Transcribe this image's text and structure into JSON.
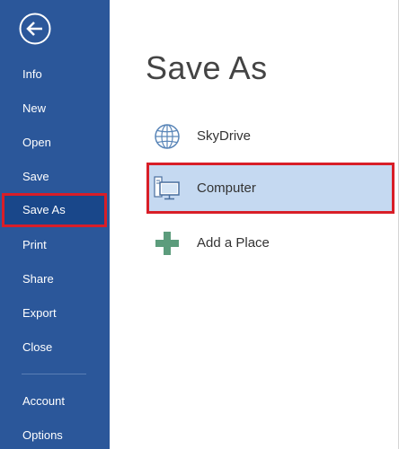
{
  "sidebar": {
    "back_label": "Back",
    "items": [
      {
        "label": "Info"
      },
      {
        "label": "New"
      },
      {
        "label": "Open"
      },
      {
        "label": "Save"
      },
      {
        "label": "Save As"
      },
      {
        "label": "Print"
      },
      {
        "label": "Share"
      },
      {
        "label": "Export"
      },
      {
        "label": "Close"
      },
      {
        "label": "Account"
      },
      {
        "label": "Options"
      }
    ],
    "active_item": "Save As"
  },
  "main": {
    "title": "Save As",
    "places": [
      {
        "label": "SkyDrive",
        "icon": "globe-icon"
      },
      {
        "label": "Computer",
        "icon": "computer-icon",
        "selected": true
      },
      {
        "label": "Add a Place",
        "icon": "plus-icon"
      }
    ]
  },
  "colors": {
    "sidebar_bg": "#2b579a",
    "highlight_outline": "#d81e28",
    "selected_bg": "#c5d9f1"
  }
}
